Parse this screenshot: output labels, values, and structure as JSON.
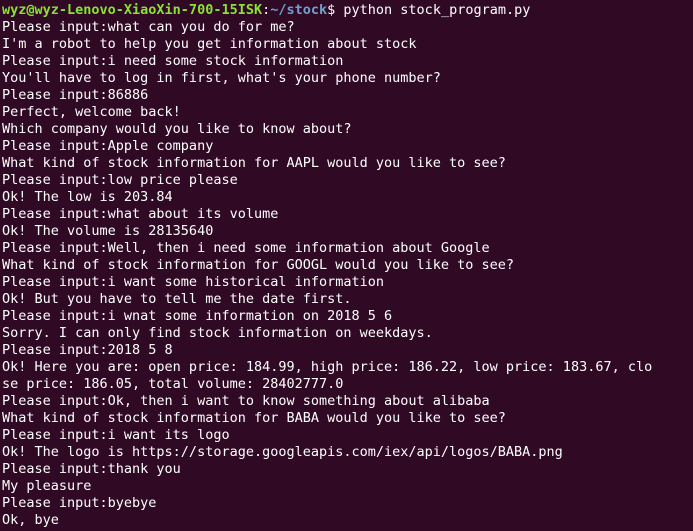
{
  "theme": {
    "background": "#300a24",
    "text": "#ffffff",
    "prompt_user_color": "#8ae234",
    "prompt_path_color": "#729fcf"
  },
  "prompt": {
    "user_host": "wyz@wyz-Lenovo-XiaoXin-700-15ISK",
    "colon": ":",
    "path": "~/stock",
    "dollar": "$",
    "command": " python stock_program.py"
  },
  "output_lines": [
    "Please input:what can you do for me?",
    "I'm a robot to help you get information about stock",
    "Please input:i need some stock information",
    "You'll have to log in first, what's your phone number?",
    "Please input:86886",
    "Perfect, welcome back!",
    "Which company would you like to know about?",
    "Please input:Apple company",
    "What kind of stock information for AAPL would you like to see?",
    "Please input:low price please",
    "Ok! The low is 203.84",
    "Please input:what about its volume",
    "Ok! The volume is 28135640",
    "Please input:Well, then i need some information about Google",
    "What kind of stock information for GOOGL would you like to see?",
    "Please input:i want some historical information",
    "Ok! But you have to tell me the date first.",
    "Please input:i wnat some information on 2018 5 6",
    "Sorry. I can only find stock information on weekdays.",
    "Please input:2018 5 8",
    "Ok! Here you are: open price: 184.99, high price: 186.22, low price: 183.67, clo",
    "se price: 186.05, total volume: 28402777.0",
    "Please input:Ok, then i want to know something about alibaba",
    "What kind of stock information for BABA would you like to see?",
    "Please input:i want its logo",
    "Ok! The logo is https://storage.googleapis.com/iex/api/logos/BABA.png",
    "Please input:thank you",
    "My pleasure",
    "Please input:byebye",
    "Ok, bye"
  ]
}
